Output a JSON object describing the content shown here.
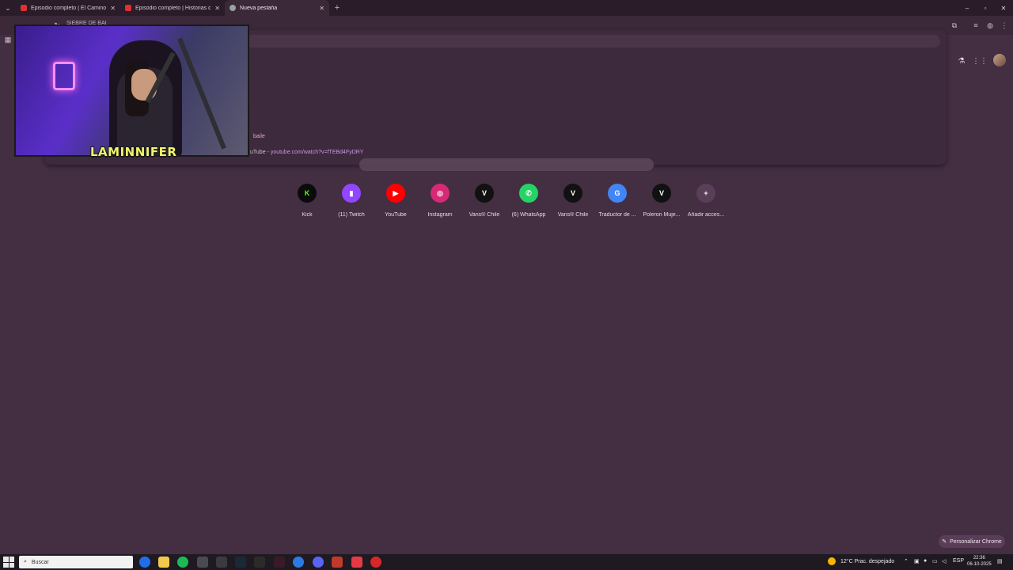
{
  "tabs": [
    {
      "title": "Episodio completo | El Camino",
      "favicon": "youtube-icon"
    },
    {
      "title": "Episodio completo | Historias d",
      "favicon": "youtube-icon"
    },
    {
      "title": "Nueva pestaña",
      "favicon": "chrome-icon"
    }
  ],
  "window_controls": {
    "minimize": "–",
    "maximize": "▫",
    "close": "✕"
  },
  "toolbar": {
    "omnibox_text": "SIEBRE DE BAI"
  },
  "suggestions": {
    "line1": "baile",
    "line2_prefix": "uTube - ",
    "line2_url": "youtube.com/watch?v=fTEBd4FyDRY"
  },
  "webcam": {
    "streamer_logo": "LAMINNIFER"
  },
  "shortcuts": [
    {
      "label": "Kick",
      "glyph": "K",
      "color": "#53fc18",
      "bg": "#0b0b0b"
    },
    {
      "label": "(11) Twitch",
      "glyph": "▮",
      "color": "#ffffff",
      "bg": "#9146ff"
    },
    {
      "label": "YouTube",
      "glyph": "▶",
      "color": "#ffffff",
      "bg": "#ff0000"
    },
    {
      "label": "Instagram",
      "glyph": "◎",
      "color": "#ffffff",
      "bg": "#d62976"
    },
    {
      "label": "Vans® Chile",
      "glyph": "V",
      "color": "#ffffff",
      "bg": "#111111"
    },
    {
      "label": "(6) WhatsApp",
      "glyph": "✆",
      "color": "#ffffff",
      "bg": "#25d366"
    },
    {
      "label": "Vans® Chile",
      "glyph": "V",
      "color": "#ffffff",
      "bg": "#111111"
    },
    {
      "label": "Traductor de ...",
      "glyph": "G",
      "color": "#ffffff",
      "bg": "#4285f4"
    },
    {
      "label": "Poleron Muje...",
      "glyph": "V",
      "color": "#ffffff",
      "bg": "#111111"
    },
    {
      "label": "Añadir acces...",
      "glyph": "+",
      "color": "#ffffff",
      "bg": "#5a3f59"
    }
  ],
  "customize": {
    "label": "Personalizar Chrome",
    "icon": "pencil-icon"
  },
  "taskbar": {
    "search_placeholder": "Buscar",
    "weather": "12°C  Prac. despejado",
    "language": "ESP",
    "time": "22:36",
    "date": "06-10-2025"
  },
  "colors": {
    "background": "#432e42",
    "tabstrip": "#2a1c29",
    "taskbar": "#1f1a22"
  }
}
